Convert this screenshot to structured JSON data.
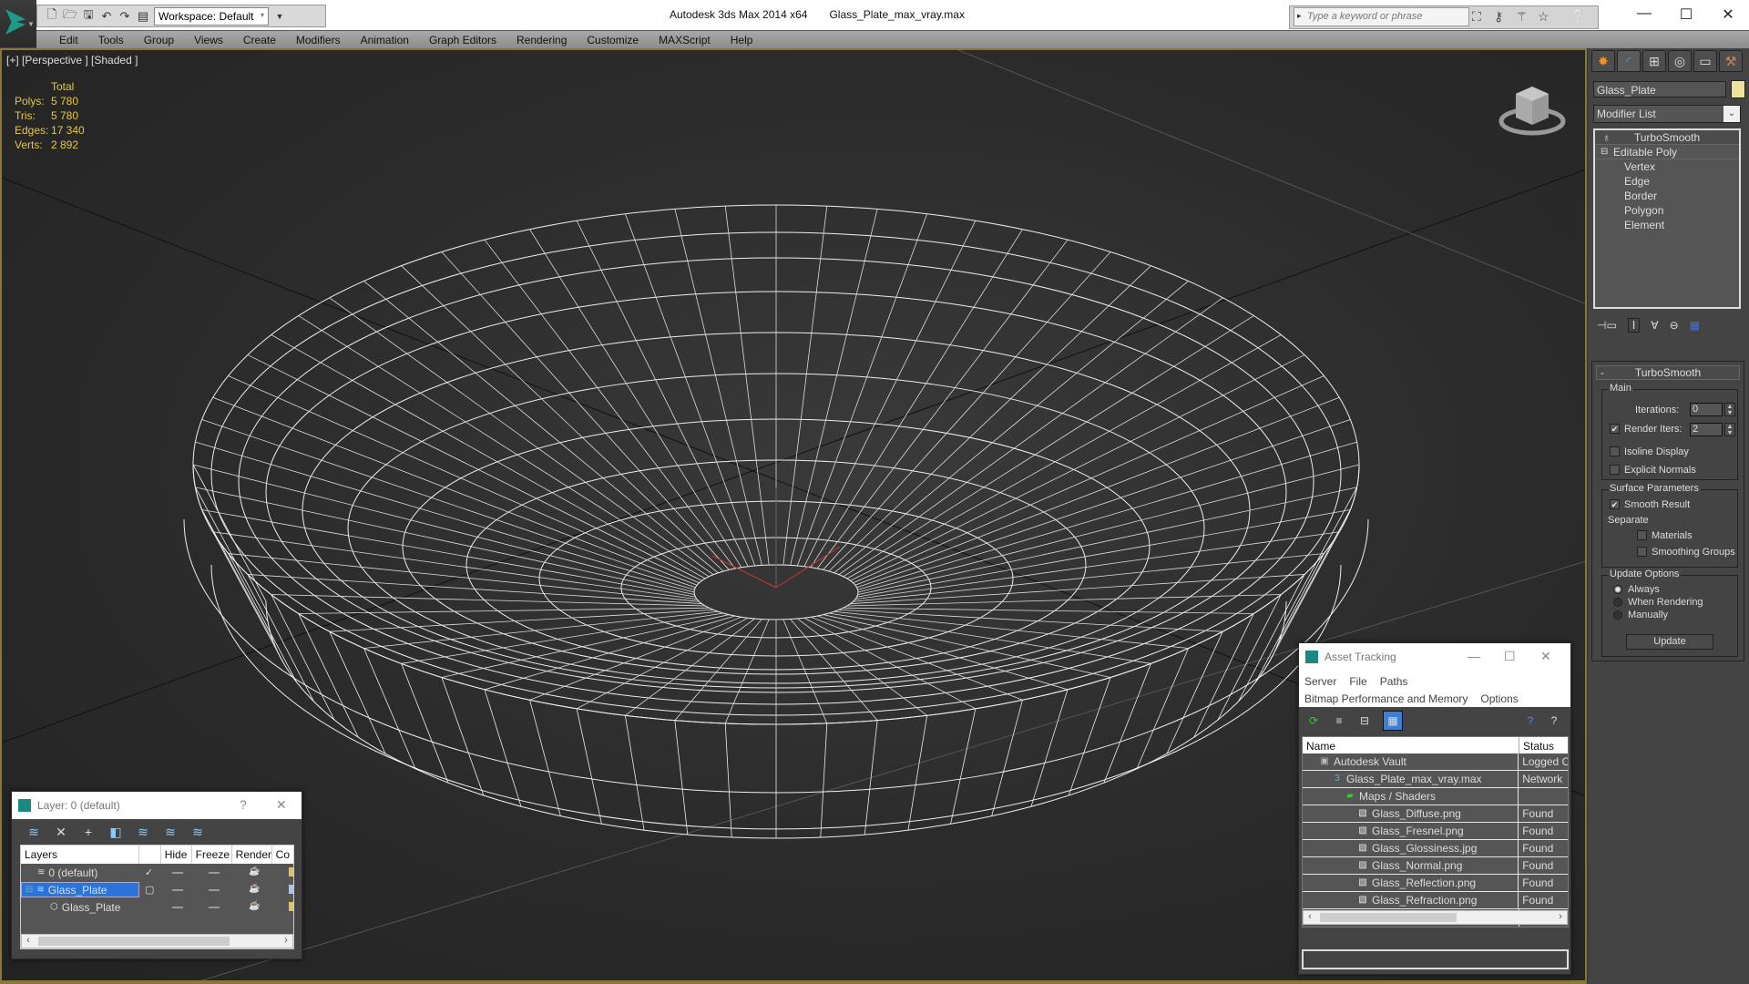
{
  "app": {
    "title": "Autodesk 3ds Max  2014 x64",
    "filename": "Glass_Plate_max_vray.max",
    "workspace": "Workspace: Default",
    "search_placeholder": "Type a keyword or phrase"
  },
  "quick_access": [
    "new-icon",
    "open-icon",
    "save-icon",
    "undo-icon",
    "redo-icon",
    "project-folder-icon"
  ],
  "menu": [
    "Edit",
    "Tools",
    "Group",
    "Views",
    "Create",
    "Modifiers",
    "Animation",
    "Graph Editors",
    "Rendering",
    "Customize",
    "MAXScript",
    "Help"
  ],
  "viewport": {
    "label": "[+] [Perspective ] [Shaded ]",
    "stats": {
      "header": "Total",
      "rows": [
        {
          "k": "Polys:",
          "v": "5 780"
        },
        {
          "k": "Tris:",
          "v": "5 780"
        },
        {
          "k": "Edges:",
          "v": "17 340"
        },
        {
          "k": "Verts:",
          "v": "2 892"
        }
      ]
    },
    "border_color": "#8a7636",
    "stats_color": "#e6c93a"
  },
  "command_panel": {
    "tabs": [
      "create-icon",
      "modify-icon",
      "hierarchy-icon",
      "motion-icon",
      "display-icon",
      "utilities-icon"
    ],
    "object_name": "Glass_Plate",
    "object_color": "#efe29e",
    "modifier_list": "Modifier List",
    "stack": [
      {
        "label": "TurboSmooth",
        "level": 0
      },
      {
        "label": "Editable Poly",
        "level": 0
      },
      {
        "label": "Vertex",
        "level": 1
      },
      {
        "label": "Edge",
        "level": 1
      },
      {
        "label": "Border",
        "level": 1
      },
      {
        "label": "Polygon",
        "level": 1
      },
      {
        "label": "Element",
        "level": 1
      }
    ],
    "turbosmooth": {
      "title": "TurboSmooth",
      "main_group": "Main",
      "iterations_label": "Iterations:",
      "iterations": "0",
      "render_iters_label": "Render Iters:",
      "render_iters": "2",
      "render_iters_checked": true,
      "isoline_label": "Isoline Display",
      "isoline_checked": false,
      "explicit_label": "Explicit Normals",
      "explicit_checked": false,
      "surface_group": "Surface Parameters",
      "smooth_result_label": "Smooth Result",
      "smooth_result_checked": true,
      "separate_label": "Separate",
      "materials_label": "Materials",
      "smoothing_groups_label": "Smoothing Groups",
      "update_group": "Update Options",
      "update_options": [
        "Always",
        "When Rendering",
        "Manually"
      ],
      "update_selected": "Always",
      "update_button": "Update"
    }
  },
  "asset_tracking": {
    "title": "Asset Tracking",
    "menu_row1": [
      "Server",
      "File",
      "Paths"
    ],
    "menu_row2": [
      "Bitmap Performance and Memory",
      "Options"
    ],
    "columns": [
      "Name",
      "Status"
    ],
    "rows": [
      {
        "name": "Autodesk Vault",
        "status": "Logged O",
        "indent": 1,
        "icon": "vault-icon"
      },
      {
        "name": "Glass_Plate_max_vray.max",
        "status": "Network",
        "indent": 2,
        "icon": "max-file-icon"
      },
      {
        "name": "Maps / Shaders",
        "status": "",
        "indent": 3,
        "icon": "maps-icon"
      },
      {
        "name": "Glass_Diffuse.png",
        "status": "Found",
        "indent": 4,
        "icon": "bitmap-icon"
      },
      {
        "name": "Glass_Fresnel.png",
        "status": "Found",
        "indent": 4,
        "icon": "bitmap-icon"
      },
      {
        "name": "Glass_Glossiness.jpg",
        "status": "Found",
        "indent": 4,
        "icon": "bitmap-icon"
      },
      {
        "name": "Glass_Normal.png",
        "status": "Found",
        "indent": 4,
        "icon": "bitmap-icon"
      },
      {
        "name": "Glass_Reflection.png",
        "status": "Found",
        "indent": 4,
        "icon": "bitmap-icon"
      },
      {
        "name": "Glass_Refraction.png",
        "status": "Found",
        "indent": 4,
        "icon": "bitmap-icon"
      }
    ]
  },
  "layer_explorer": {
    "title": "Layer: 0 (default)",
    "help": "?",
    "columns": [
      "Layers",
      "",
      "Hide",
      "Freeze",
      "Render",
      "Co"
    ],
    "rows": [
      {
        "name": "0 (default)",
        "current": true,
        "selected": false,
        "color": "#e0c35a",
        "indent": 1
      },
      {
        "name": "Glass_Plate",
        "current": false,
        "selected": true,
        "color": "#a8c4f0",
        "indent": 0
      },
      {
        "name": "Glass_Plate",
        "current": false,
        "selected": false,
        "color": "#e0c35a",
        "indent": 2
      }
    ]
  }
}
